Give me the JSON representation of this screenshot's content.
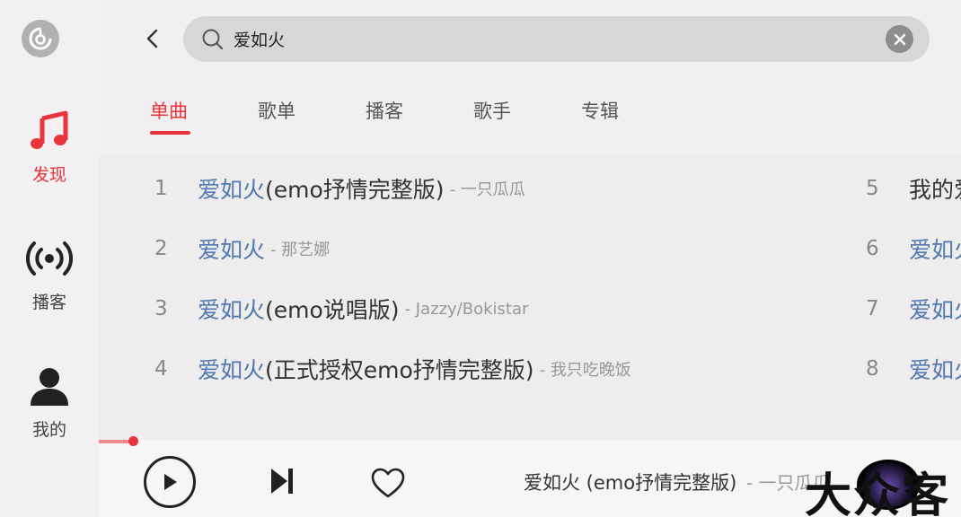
{
  "sidebar": {
    "items": [
      {
        "label": "发现",
        "icon": "music-note-icon",
        "active": true
      },
      {
        "label": "播客",
        "icon": "broadcast-icon",
        "active": false
      },
      {
        "label": "我的",
        "icon": "user-icon",
        "active": false
      }
    ]
  },
  "search": {
    "query": "爱如火",
    "placeholder": ""
  },
  "tabs": [
    {
      "label": "单曲",
      "active": true
    },
    {
      "label": "歌单",
      "active": false
    },
    {
      "label": "播客",
      "active": false
    },
    {
      "label": "歌手",
      "active": false
    },
    {
      "label": "专辑",
      "active": false
    }
  ],
  "results": [
    {
      "num": "1",
      "title_hl": "爱如火",
      "title_rest": " (emo抒情完整版)",
      "artist": "- 一只瓜瓜"
    },
    {
      "num": "2",
      "title_hl": "爱如火",
      "title_rest": "",
      "artist": "- 那艺娜"
    },
    {
      "num": "3",
      "title_hl": "爱如火",
      "title_rest": " (emo说唱版)",
      "artist": "- Jazzy/Bokistar"
    },
    {
      "num": "4",
      "title_hl": "爱如火",
      "title_rest": " (正式授权emo抒情完整版)",
      "artist": "- 我只吃晚饭"
    },
    {
      "num": "5",
      "title_hl": "",
      "title_rest": "我的爱",
      "artist": ""
    },
    {
      "num": "6",
      "title_hl": "爱如火",
      "title_rest": "",
      "artist": ""
    },
    {
      "num": "7",
      "title_hl": "爱如火",
      "title_rest": "",
      "artist": ""
    },
    {
      "num": "8",
      "title_hl": "爱如火",
      "title_rest": "",
      "artist": ""
    }
  ],
  "player": {
    "title": "爱如火 (emo抒情完整版)",
    "artist": "- 一只瓜瓜",
    "progress": 0.04
  },
  "watermark": {
    "text": "大众客"
  },
  "colors": {
    "accent": "#e8343a",
    "highlight": "#4f79b0"
  }
}
